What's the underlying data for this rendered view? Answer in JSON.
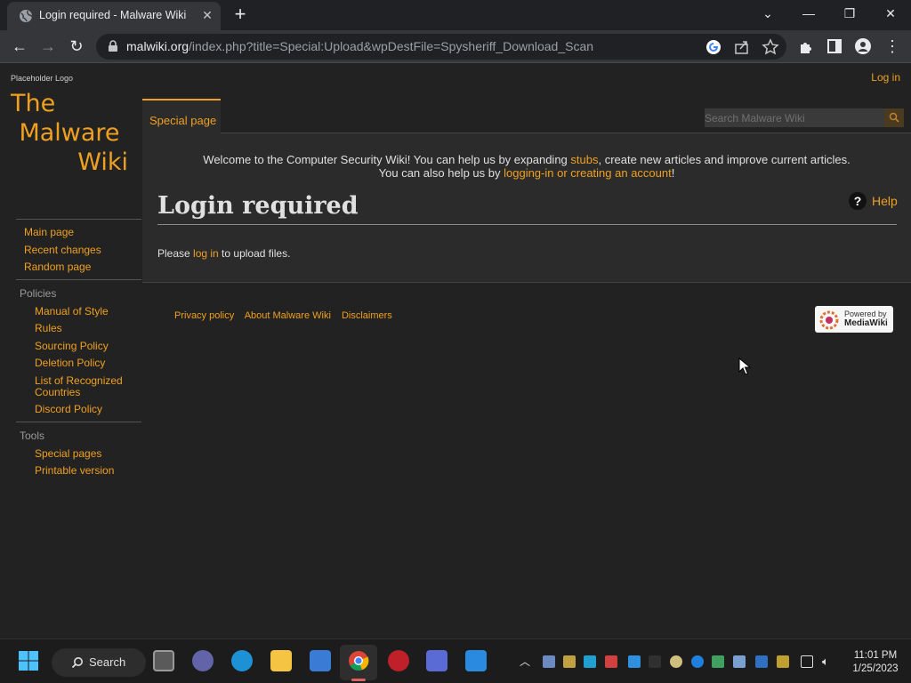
{
  "browser": {
    "tab_title": "Login required - Malware Wiki",
    "url_host": "malwiki.org",
    "url_path": "/index.php?title=Special:Upload&wpDestFile=Spysheriff_Download_Scan"
  },
  "wiki": {
    "logo_caption": "Placeholder Logo",
    "logo_lines": [
      "The",
      "Malware",
      "Wiki"
    ],
    "login_link": "Log in",
    "special_tab": "Special page",
    "search_placeholder": "Search Malware Wiki",
    "sitenotice": {
      "line1_a": "Welcome to the Computer Security Wiki! You can help us by expanding ",
      "line1_link": "stubs",
      "line1_b": ", create new articles and improve current articles.",
      "line2_a": "You can also help us by ",
      "line2_link": "logging-in or creating an account",
      "line2_b": "!"
    },
    "heading": "Login required",
    "help_label": "Help",
    "body": {
      "before": "Please ",
      "link": "log in",
      "after": " to upload files."
    },
    "sidebar": {
      "nav": [
        "Main page",
        "Recent changes",
        "Random page"
      ],
      "policies_heading": "Policies",
      "policies": [
        "Manual of Style",
        "Rules",
        "Sourcing Policy",
        "Deletion Policy",
        "List of Recognized Countries",
        "Discord Policy"
      ],
      "tools_heading": "Tools",
      "tools": [
        "Special pages",
        "Printable version"
      ]
    },
    "footer": [
      "Privacy policy",
      "About Malware Wiki",
      "Disclaimers"
    ],
    "powered_line1": "Powered by",
    "powered_line2": "MediaWiki"
  },
  "taskbar": {
    "search_label": "Search",
    "time": "11:01 PM",
    "date": "1/25/2023"
  },
  "colors": {
    "accent": "#f0a020",
    "page_bg": "#222222",
    "content_bg": "#2b2b2b"
  }
}
